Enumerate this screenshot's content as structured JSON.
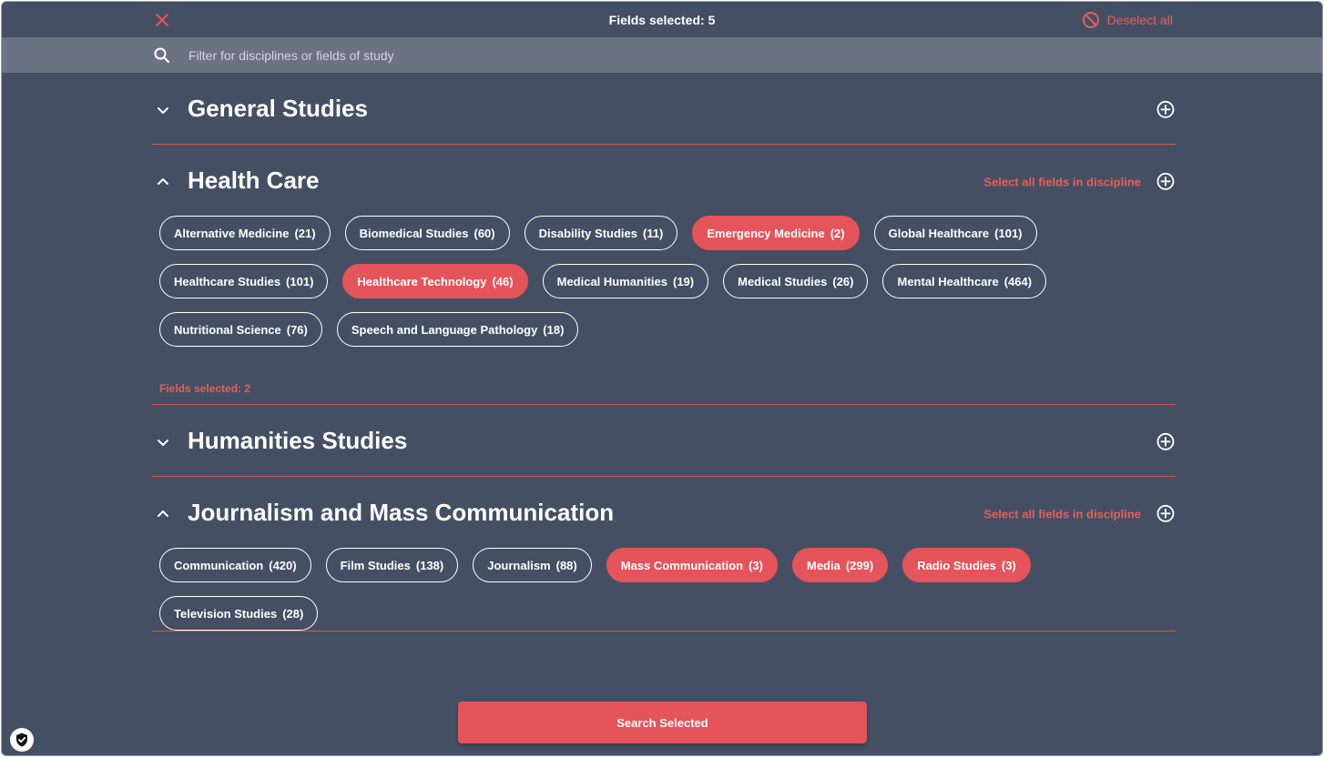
{
  "colors": {
    "background": "#444f63",
    "searchbar": "#6b7281",
    "accent": "#e4545a",
    "accent_text": "#e4605a",
    "divider": "#d0565b"
  },
  "topbar": {
    "close_icon": "close-x-icon",
    "title": "Fields selected: 5",
    "deselect_icon": "prohibited-icon",
    "deselect_label": "Deselect all"
  },
  "search": {
    "icon": "search-icon",
    "placeholder": "Filter for disciplines or fields of study",
    "value": ""
  },
  "disciplines": [
    {
      "title": "General Studies",
      "expanded": false,
      "select_all_label": "",
      "fields": [],
      "fields_selected": ""
    },
    {
      "title": "Health Care",
      "expanded": true,
      "select_all_label": "Select all fields in discipline",
      "fields": [
        {
          "name": "Alternative Medicine",
          "count": "(21)",
          "selected": false
        },
        {
          "name": "Biomedical Studies",
          "count": "(60)",
          "selected": false
        },
        {
          "name": "Disability Studies",
          "count": "(11)",
          "selected": false
        },
        {
          "name": "Emergency Medicine",
          "count": "(2)",
          "selected": true
        },
        {
          "name": "Global Healthcare",
          "count": "(101)",
          "selected": false
        },
        {
          "name": "Healthcare Studies",
          "count": "(101)",
          "selected": false
        },
        {
          "name": "Healthcare Technology",
          "count": "(46)",
          "selected": true
        },
        {
          "name": "Medical Humanities",
          "count": "(19)",
          "selected": false
        },
        {
          "name": "Medical Studies",
          "count": "(26)",
          "selected": false
        },
        {
          "name": "Mental Healthcare",
          "count": "(464)",
          "selected": false
        },
        {
          "name": "Nutritional Science",
          "count": "(76)",
          "selected": false
        },
        {
          "name": "Speech and Language Pathology",
          "count": "(18)",
          "selected": false
        }
      ],
      "fields_selected": "Fields selected: 2"
    },
    {
      "title": "Humanities Studies",
      "expanded": false,
      "select_all_label": "",
      "fields": [],
      "fields_selected": ""
    },
    {
      "title": "Journalism and Mass Communication",
      "expanded": true,
      "select_all_label": "Select all fields in discipline",
      "fields": [
        {
          "name": "Communication",
          "count": "(420)",
          "selected": false
        },
        {
          "name": "Film Studies",
          "count": "(138)",
          "selected": false
        },
        {
          "name": "Journalism",
          "count": "(88)",
          "selected": false
        },
        {
          "name": "Mass Communication",
          "count": "(3)",
          "selected": true
        },
        {
          "name": "Media",
          "count": "(299)",
          "selected": true
        },
        {
          "name": "Radio Studies",
          "count": "(3)",
          "selected": true
        },
        {
          "name": "Television Studies",
          "count": "(28)",
          "selected": false
        }
      ],
      "fields_selected": ""
    }
  ],
  "footer": {
    "search_selected_label": "Search Selected",
    "shield_icon": "shield-check-icon"
  }
}
